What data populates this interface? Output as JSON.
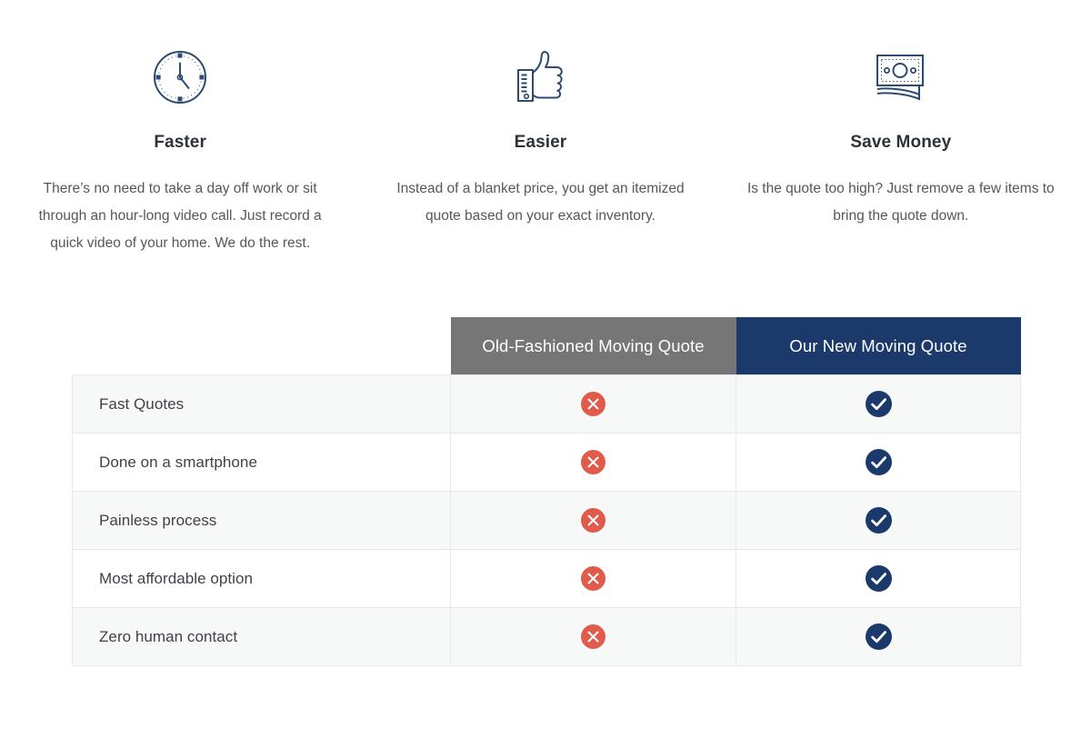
{
  "features": [
    {
      "icon": "clock-icon",
      "title": "Faster",
      "description": "There’s no need to take a day off work or sit through an hour-long video call. Just record a quick video of your home. We do the rest."
    },
    {
      "icon": "thumbs-up-icon",
      "title": "Easier",
      "description": "Instead of a blanket price, you get an itemized quote based on your exact inventory."
    },
    {
      "icon": "money-bills-icon",
      "title": "Save Money",
      "description": "Is the quote too high? Just remove a few items to bring the quote down."
    }
  ],
  "comparison": {
    "headers": {
      "label_column": "",
      "old_column": "Old-Fashioned Moving Quote",
      "new_column": "Our New Moving Quote"
    },
    "rows": [
      {
        "label": "Fast Quotes",
        "old": "cross-icon",
        "new": "check-icon"
      },
      {
        "label": "Done on a smartphone",
        "old": "cross-icon",
        "new": "check-icon"
      },
      {
        "label": "Painless process",
        "old": "cross-icon",
        "new": "check-icon"
      },
      {
        "label": "Most affordable option",
        "old": "cross-icon",
        "new": "check-icon"
      },
      {
        "label": "Zero human contact",
        "old": "cross-icon",
        "new": "check-icon"
      }
    ]
  },
  "colors": {
    "old_header_bg": "#767676",
    "new_header_bg": "#1b3a6b",
    "cross_circle": "#e15b4c",
    "check_circle": "#1b3a6b",
    "icon_stroke": "#2c4a72",
    "row_alt_bg": "#f7f8f8",
    "row_border": "#e6e8ea",
    "heading_text": "#2d3237",
    "body_text": "#53585d"
  }
}
